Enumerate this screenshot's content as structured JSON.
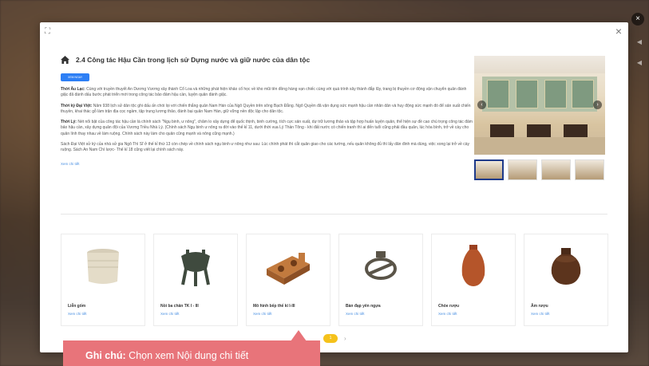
{
  "article": {
    "title": "2.4 Công tác Hậu Cần trong lịch sử Dựng nước và giữ nước của dân tộc",
    "tag_button": "XEM NGAY",
    "p1_label": "Thời Âu Lạc:",
    "p1_text": " Cùng với truyền thuyết An Dương Vương xây thành Cổ Loa và những phát hiện khảo cổ học về kho mũi tên đồng hàng vạn chiếc cùng với quá trình xây thành đắp lũy, trang bị thuyền cơ động vận chuyển quân đánh giặc đã đánh dấu bước phát triển mới trong công tác bảo đảm hậu cần, luyện quân đánh giặc.",
    "p2_label": "Thời kỳ Đại Việt:",
    "p2_text": " Năm 938 lịch sử dân tộc ghi dấu ấn chói lọi với chiến thắng quân Nam Hán của Ngô Quyền trên sông Bạch Đằng. Ngô Quyền đã vận dụng sức mạnh hậu cần nhân dân và huy động sức mạnh đó để sản xuất chiến thuyền, khai thác gỗ làm trận địa cọc ngầm, tập trung lương thảo, đánh bại quân Nam Hán, giữ vững nền độc lập cho dân tộc.",
    "p3_label": "Thời Lý:",
    "p3_text": " Nét nổi bật của công tác hậu cần là chính sách \"Ngụ binh, ư nông\", chăm lo xây dựng để quốc thịnh, binh cường, tích cực sản xuất, dự trữ lương thảo và tập hợp huấn luyện quân, thể hiện sự đề cao chú trọng công tác đảm bảo hậu cần, xây dựng quân đội của Vương Triều Nhà Lý. (Chính sách Ngụ binh ư nông ra đời vào thế kỉ 11, dưới thời vua Lý Thần Tông - khi đất nước có chiến tranh thì ai đến tuổi cũng phải đầu quân, lúc hòa bình, trở về cày cho quân lính thay nhau về làm ruộng. Chính sách này làm cho quân cũng mạnh và nông cũng mạnh.)",
    "p4_text": "Sách Đại Việt sử ký của nhà sử gia Ngô Thì Sĩ ở thế kỉ thứ 13 còn chép về chính sách ngụ binh ư nông như sau: Lúc chính phát thì cắt quân giao cho các tướng, nếu quân không đủ thì lấy dân đinh mà dùng, việc xong lại trở về cày ruộng. Sách An Nam Chí lược- Thế kỉ 18 cũng viết lại chính sách này.",
    "more_link": "Xem chi tiết"
  },
  "gallery": {
    "prev_icon": "‹",
    "next_icon": "›"
  },
  "artifacts": [
    {
      "name": "Liễn gốm",
      "link": "Xem chi tiết"
    },
    {
      "name": "Nồi ba chân TK I - III",
      "link": "Xem chi tiết"
    },
    {
      "name": "Mô hình bếp thế kỉ I-III",
      "link": "Xem chi tiết"
    },
    {
      "name": "Bàn đạp yên ngựa",
      "link": "Xem chi tiết"
    },
    {
      "name": "Chóe rượu",
      "link": "Xem chi tiết"
    },
    {
      "name": "Âm rượu",
      "link": "Xem chi tiết"
    }
  ],
  "pagination": {
    "current": "1",
    "next": "›"
  },
  "note": {
    "label": "Ghi chú:",
    "text": " Chọn xem Nội dung chi tiết"
  },
  "icons": {
    "close": "×",
    "expand": "⛶",
    "backdrop_close": "×"
  },
  "colors": {
    "accent": "#2d7ff5",
    "link": "#4a90e2",
    "page_active": "#f5c21b",
    "note_bg": "#e8747a"
  }
}
